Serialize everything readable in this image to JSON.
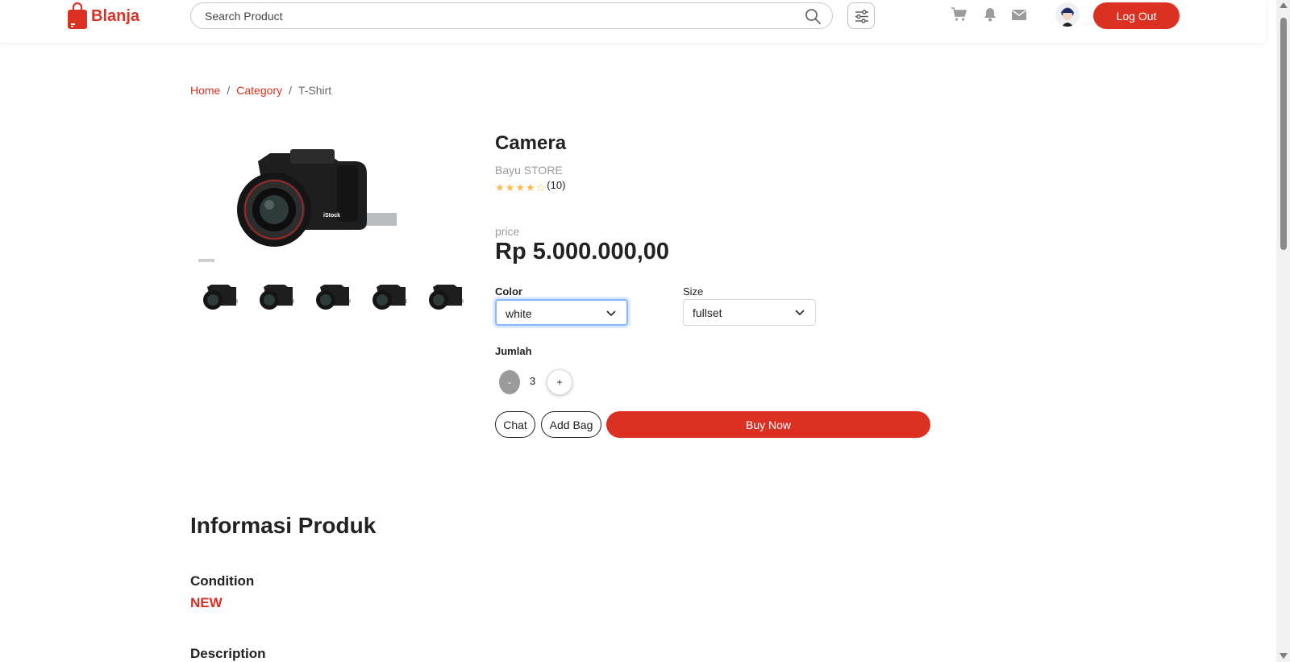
{
  "navbar": {
    "brand": "Blanja",
    "search_placeholder": "Search Product",
    "logout_label": "Log Out"
  },
  "breadcrumb": {
    "items": [
      "Home",
      "Category",
      "T-Shirt"
    ],
    "separator": "/"
  },
  "product": {
    "title": "Camera",
    "store": "Bayu STORE",
    "rating": 4,
    "rating_max": 5,
    "rating_count": "(10)",
    "price_label": "price",
    "price": "Rp 5.000.000,00",
    "gallery_thumbs_count": 5
  },
  "options": {
    "color_label": "Color",
    "color_value": "white",
    "size_label": "Size",
    "size_value": "fullset",
    "quantity_label": "Jumlah",
    "quantity_value": "3",
    "minus_label": "-",
    "plus_label": "+"
  },
  "actions": {
    "chat_label": "Chat",
    "add_bag_label": "Add Bag",
    "buy_label": "Buy Now"
  },
  "info": {
    "title": "Informasi Produk",
    "condition_label": "Condition",
    "condition_value": "NEW",
    "description_label": "Description"
  },
  "colors": {
    "brand": "#DB3022",
    "star": "#FFBA49",
    "muted": "#9b9b9b"
  }
}
